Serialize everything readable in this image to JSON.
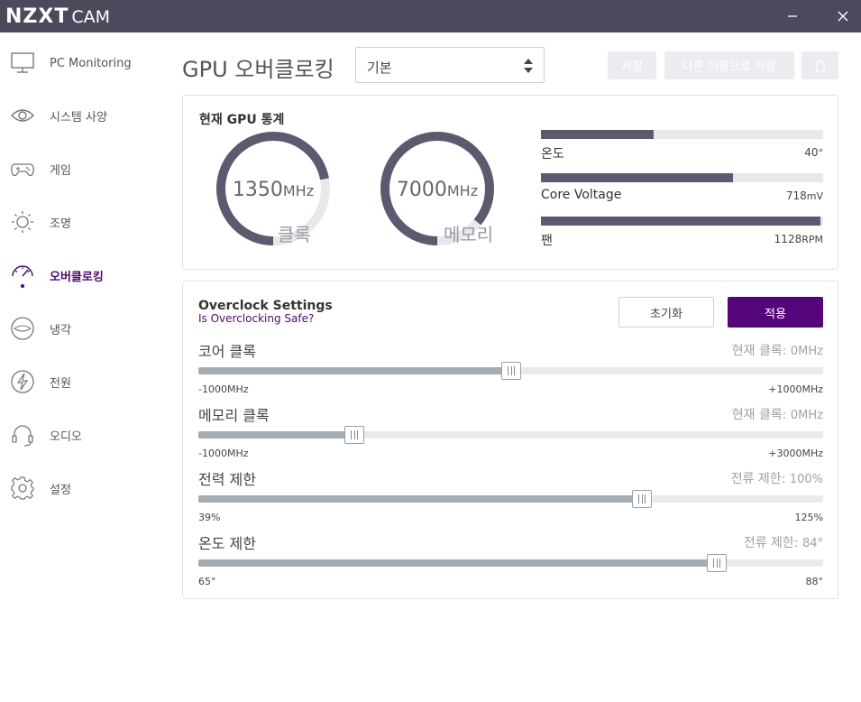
{
  "app": {
    "brand": "NZXT",
    "product": "CAM"
  },
  "colors": {
    "titlebar": "#4a4a5c",
    "accent": "#55057b",
    "gauge_fill": "#5c5a6e",
    "gauge_track": "#e6e8ec"
  },
  "sidebar": {
    "items": [
      {
        "label": "PC Monitoring",
        "icon": "monitor-icon",
        "active": false
      },
      {
        "label": "시스템 사양",
        "icon": "eye-icon",
        "active": false
      },
      {
        "label": "게임",
        "icon": "gamepad-icon",
        "active": false
      },
      {
        "label": "조명",
        "icon": "sun-icon",
        "active": false
      },
      {
        "label": "오버클로킹",
        "icon": "speedometer-icon",
        "active": true
      },
      {
        "label": "냉각",
        "icon": "cooling-icon",
        "active": false
      },
      {
        "label": "전원",
        "icon": "lightning-icon",
        "active": false
      },
      {
        "label": "오디오",
        "icon": "headset-icon",
        "active": false
      },
      {
        "label": "설정",
        "icon": "gear-icon",
        "active": false
      }
    ]
  },
  "header": {
    "title": "GPU 오버클로킹",
    "profile": "기본",
    "save_label": "저장",
    "save_as_label": "다른 이름으로 저장"
  },
  "stats": {
    "title": "현재 GPU 통계",
    "clock": {
      "value": "1350",
      "unit": "MHz",
      "label": "클록",
      "fraction": 0.72
    },
    "memory": {
      "value": "7000",
      "unit": "MHz",
      "label": "메모리",
      "fraction": 0.86
    },
    "bars": [
      {
        "label": "온도",
        "value": "40",
        "unit": "°",
        "fraction": 0.4
      },
      {
        "label": "Core Voltage",
        "value": "718",
        "unit": "mV",
        "fraction": 0.68
      },
      {
        "label": "팬",
        "value": "1128",
        "unit": "RPM",
        "fraction": 0.99
      }
    ]
  },
  "overclock": {
    "title": "Overclock Settings",
    "safe_link": "Is Overclocking Safe?",
    "reset_label": "초기화",
    "apply_label": "적용",
    "sliders": [
      {
        "name": "코어 클록",
        "current_label": "현재 클록:",
        "current_value": "0MHz",
        "min": "-1000MHz",
        "max": "+1000MHz",
        "fraction": 0.5
      },
      {
        "name": "메모리 클록",
        "current_label": "현재 클록:",
        "current_value": "0MHz",
        "min": "-1000MHz",
        "max": "+3000MHz",
        "fraction": 0.25
      },
      {
        "name": "전력 제한",
        "current_label": "전류 제한:",
        "current_value": "100%",
        "min": "39%",
        "max": "125%",
        "fraction": 0.71
      },
      {
        "name": "온도 제한",
        "current_label": "전류 제한:",
        "current_value": "84°",
        "min": "65°",
        "max": "88°",
        "fraction": 0.83
      }
    ]
  }
}
